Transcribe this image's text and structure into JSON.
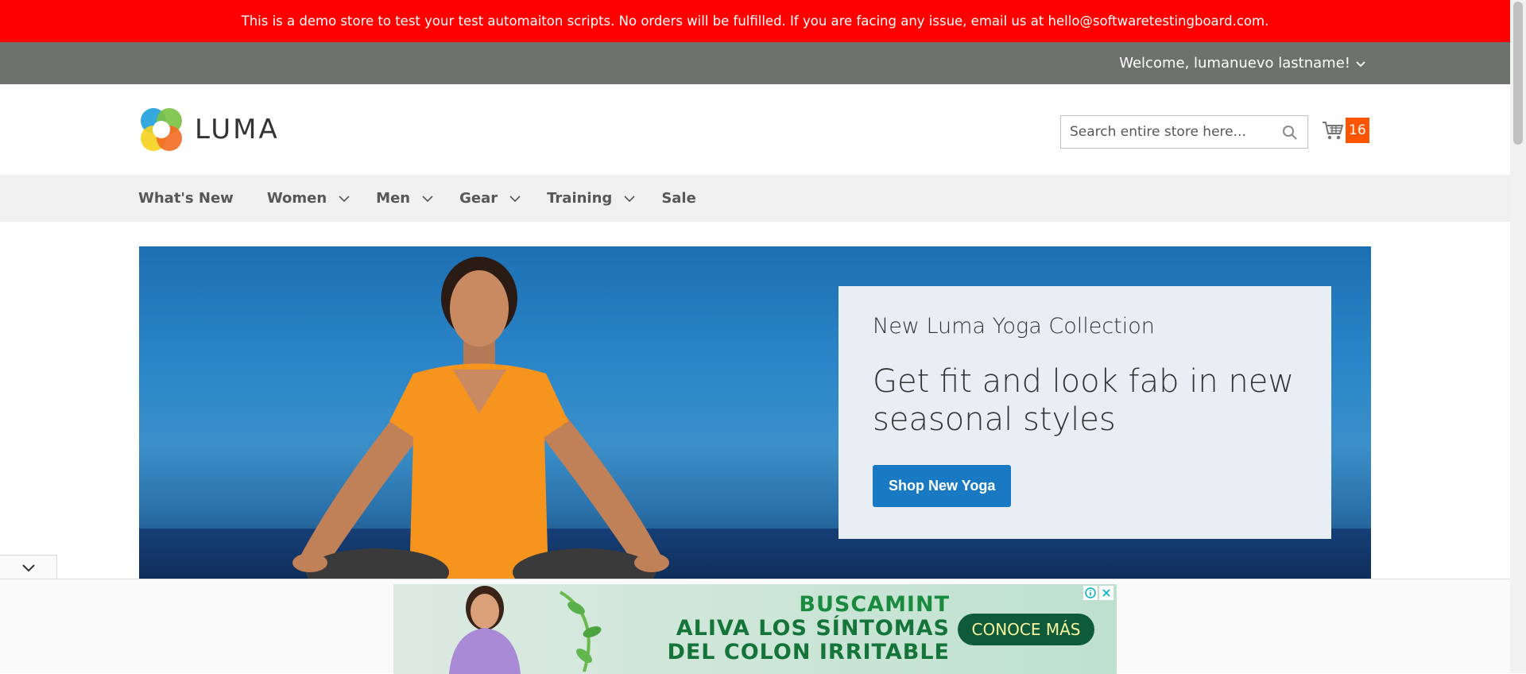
{
  "demo_notice": {
    "text": "This is a demo store to test your test automaiton scripts. No orders will be fulfilled. If you are facing any issue, email us at hello@softwaretestingboard.com."
  },
  "account": {
    "welcome": "Welcome, lumanuevo lastname!"
  },
  "header": {
    "logo_text": "LUMA",
    "search_placeholder": "Search entire store here...",
    "cart_count": "16"
  },
  "nav": {
    "items": [
      {
        "label": "What's New",
        "has_submenu": false
      },
      {
        "label": "Women",
        "has_submenu": true
      },
      {
        "label": "Men",
        "has_submenu": true
      },
      {
        "label": "Gear",
        "has_submenu": true
      },
      {
        "label": "Training",
        "has_submenu": true
      },
      {
        "label": "Sale",
        "has_submenu": false
      }
    ]
  },
  "hero": {
    "subtitle": "New Luma Yoga Collection",
    "title": "Get fit and look fab in new seasonal styles",
    "cta_label": "Shop New Yoga"
  },
  "ad": {
    "brand": "BUSCAMINT",
    "line1": "ALIVA LOS SÍNTOMAS",
    "line2": "DEL COLON IRRITABLE",
    "cta": "CONOCE MÁS"
  },
  "colors": {
    "demo_bar": "#ff0000",
    "panel_bar": "#6e716e",
    "nav_bg": "#f0f0f0",
    "cart_badge": "#ff5501",
    "primary_button": "#1979c3",
    "promo_bg": "#e9eef5"
  },
  "icons": {
    "search": "search-icon",
    "cart": "cart-icon",
    "chevron": "chevron-down-icon",
    "ad_info": "info-icon",
    "ad_close": "close-icon"
  }
}
